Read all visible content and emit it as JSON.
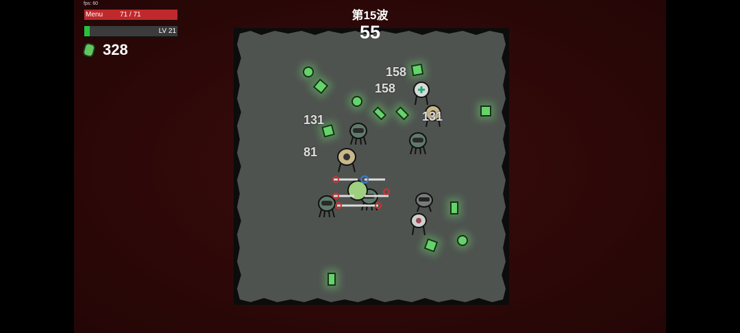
{
  "hud": {
    "fps": "fps: 60",
    "menu_label": "Menu",
    "hp_text": "71 / 71",
    "hp_fraction": 1.0,
    "level_text": "LV 21",
    "xp_fraction": 0.06,
    "materials": "328"
  },
  "wave": {
    "title": "第15波",
    "timer": "55"
  },
  "damage_numbers": [
    {
      "value": "158"
    },
    {
      "value": "158"
    },
    {
      "value": "131"
    },
    {
      "value": "131"
    },
    {
      "value": "81"
    }
  ],
  "colors": {
    "hp": "#c0292c",
    "xp": "#27c23a",
    "material": "#64d46a",
    "arena": "#4f5350",
    "backdrop": "#2e0808"
  }
}
